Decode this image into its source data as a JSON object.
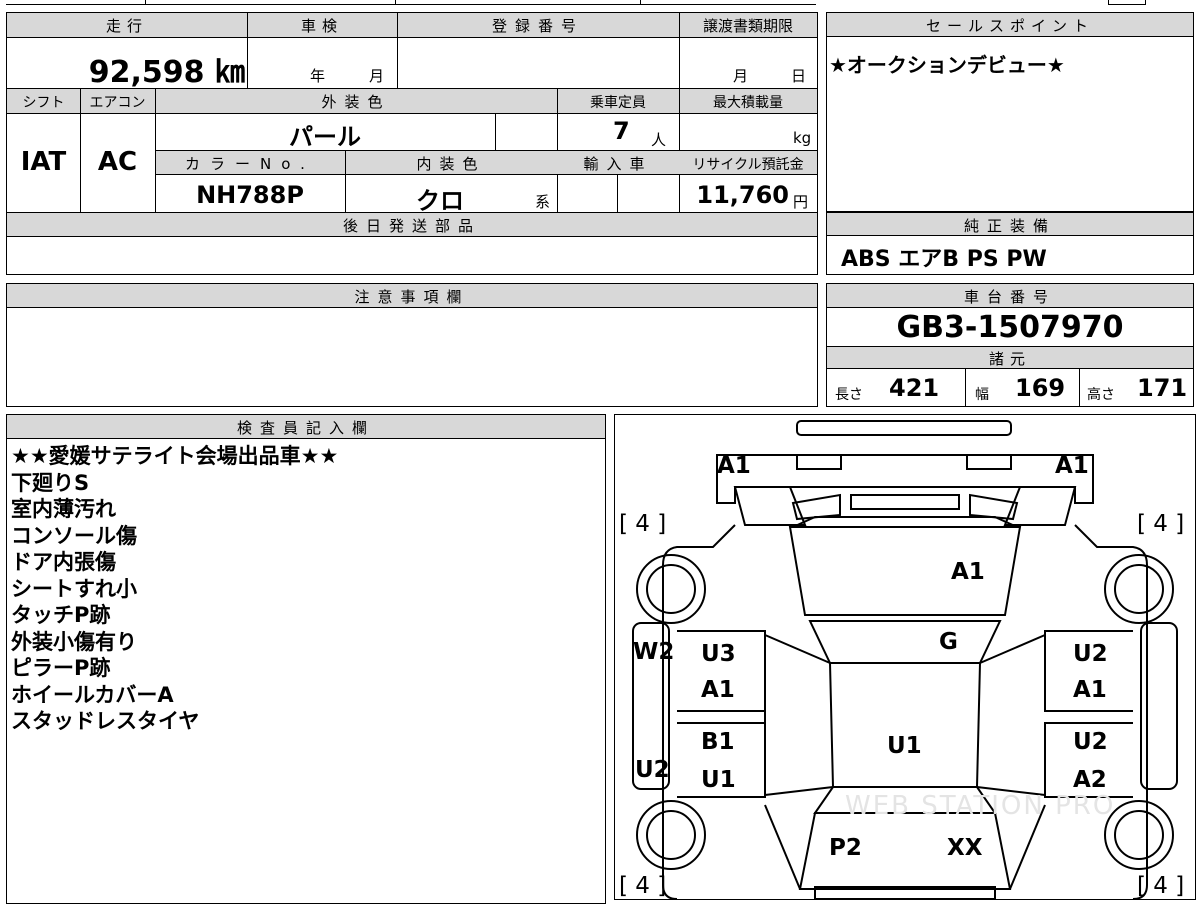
{
  "top_table": {
    "mileage_header": "走行",
    "mileage": "92,598 ㎞",
    "inspection_header": "車検",
    "inspection_year_unit": "年",
    "inspection_month_unit": "月",
    "registration_header": "登録番号",
    "transfer_header": "譲渡書類期限",
    "transfer_month_unit": "月",
    "transfer_day_unit": "日",
    "shift_header": "シフト",
    "ac_header": "エアコン",
    "ext_color_header": "外装色",
    "capacity_header": "乗車定員",
    "max_load_header": "最大積載量",
    "shift": "IAT",
    "ac": "AC",
    "ext_color": "パール",
    "capacity": "7",
    "capacity_unit": "人",
    "max_load_unit": "kg",
    "color_no_header": "カラーNo.",
    "int_color_header": "内装色",
    "import_header": "輸入車",
    "recycle_header": "リサイクル預託金",
    "color_no": "NH788P",
    "int_color": "クロ",
    "int_color_suffix": "系",
    "recycle_fee": "11,760",
    "recycle_unit": "円",
    "later_parts_header": "後日発送部品"
  },
  "sales_point": {
    "header": "セールスポイント",
    "text": "★オークションデビュー★"
  },
  "equipment": {
    "header": "純正装備",
    "text": "ABS エアB PS PW"
  },
  "caution": {
    "header": "注意事項欄"
  },
  "chassis": {
    "header": "車台番号",
    "number": "GB3-1507970",
    "specs_header": "諸元",
    "length_label": "長さ",
    "length": "421",
    "width_label": "幅",
    "width": "169",
    "height_label": "高さ",
    "height": "171"
  },
  "inspector": {
    "header": "検査員記入欄",
    "lines": [
      "★★愛媛サテライト会場出品車★★",
      "下廻りS",
      "室内薄汚れ",
      "コンソール傷",
      "ドア内張傷",
      "シートすれ小",
      "タッチP跡",
      "外装小傷有り",
      "ピラーP跡",
      "ホイールカバーA",
      "スタッドレスタイヤ"
    ]
  },
  "diagram": {
    "tire_fl": "[ 4 ]",
    "tire_fr": "[ 4 ]",
    "tire_rl": "[ 4 ]",
    "tire_rr": "[ 4 ]",
    "front_left": "A1",
    "front_right": "A1",
    "hood": "A1",
    "windshield": "G",
    "left_fender": "W2",
    "left_rear_fender": "U2",
    "front_left_door_1": "U3",
    "front_left_door_2": "A1",
    "rear_left_door_1": "B1",
    "rear_left_door_2": "U1",
    "front_right_door_1": "U2",
    "front_right_door_2": "A1",
    "rear_right_door_1": "U2",
    "rear_right_door_2": "A2",
    "roof": "U1",
    "rear_left": "P2",
    "rear_right": "XX",
    "watermark": "WEB STATION PRO"
  }
}
